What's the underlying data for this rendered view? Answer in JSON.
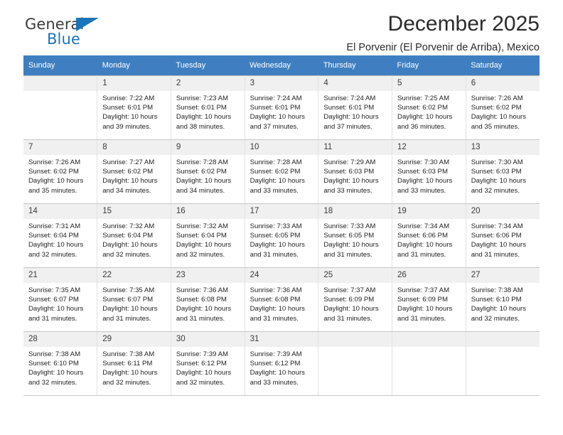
{
  "brand": {
    "name_part1": "General",
    "name_part2": "Blue",
    "logo_icon": "triangle-logo-icon"
  },
  "header": {
    "month_title": "December 2025",
    "location": "El Porvenir (El Porvenir de Arriba), Mexico"
  },
  "colors": {
    "header_row_bg": "#3f7fc1",
    "brand_blue": "#1b75bb",
    "daynum_bg": "#f0f0f0",
    "cell_border": "#c8c8c8"
  },
  "calendar": {
    "weekday_headers": [
      "Sunday",
      "Monday",
      "Tuesday",
      "Wednesday",
      "Thursday",
      "Friday",
      "Saturday"
    ],
    "weeks": [
      [
        {
          "day": "",
          "sunrise": "",
          "sunset": "",
          "daylight1": "",
          "daylight2": "",
          "empty": true
        },
        {
          "day": "1",
          "sunrise": "Sunrise: 7:22 AM",
          "sunset": "Sunset: 6:01 PM",
          "daylight1": "Daylight: 10 hours",
          "daylight2": "and 39 minutes."
        },
        {
          "day": "2",
          "sunrise": "Sunrise: 7:23 AM",
          "sunset": "Sunset: 6:01 PM",
          "daylight1": "Daylight: 10 hours",
          "daylight2": "and 38 minutes."
        },
        {
          "day": "3",
          "sunrise": "Sunrise: 7:24 AM",
          "sunset": "Sunset: 6:01 PM",
          "daylight1": "Daylight: 10 hours",
          "daylight2": "and 37 minutes."
        },
        {
          "day": "4",
          "sunrise": "Sunrise: 7:24 AM",
          "sunset": "Sunset: 6:01 PM",
          "daylight1": "Daylight: 10 hours",
          "daylight2": "and 37 minutes."
        },
        {
          "day": "5",
          "sunrise": "Sunrise: 7:25 AM",
          "sunset": "Sunset: 6:02 PM",
          "daylight1": "Daylight: 10 hours",
          "daylight2": "and 36 minutes."
        },
        {
          "day": "6",
          "sunrise": "Sunrise: 7:26 AM",
          "sunset": "Sunset: 6:02 PM",
          "daylight1": "Daylight: 10 hours",
          "daylight2": "and 35 minutes."
        }
      ],
      [
        {
          "day": "7",
          "sunrise": "Sunrise: 7:26 AM",
          "sunset": "Sunset: 6:02 PM",
          "daylight1": "Daylight: 10 hours",
          "daylight2": "and 35 minutes."
        },
        {
          "day": "8",
          "sunrise": "Sunrise: 7:27 AM",
          "sunset": "Sunset: 6:02 PM",
          "daylight1": "Daylight: 10 hours",
          "daylight2": "and 34 minutes."
        },
        {
          "day": "9",
          "sunrise": "Sunrise: 7:28 AM",
          "sunset": "Sunset: 6:02 PM",
          "daylight1": "Daylight: 10 hours",
          "daylight2": "and 34 minutes."
        },
        {
          "day": "10",
          "sunrise": "Sunrise: 7:28 AM",
          "sunset": "Sunset: 6:02 PM",
          "daylight1": "Daylight: 10 hours",
          "daylight2": "and 33 minutes."
        },
        {
          "day": "11",
          "sunrise": "Sunrise: 7:29 AM",
          "sunset": "Sunset: 6:03 PM",
          "daylight1": "Daylight: 10 hours",
          "daylight2": "and 33 minutes."
        },
        {
          "day": "12",
          "sunrise": "Sunrise: 7:30 AM",
          "sunset": "Sunset: 6:03 PM",
          "daylight1": "Daylight: 10 hours",
          "daylight2": "and 33 minutes."
        },
        {
          "day": "13",
          "sunrise": "Sunrise: 7:30 AM",
          "sunset": "Sunset: 6:03 PM",
          "daylight1": "Daylight: 10 hours",
          "daylight2": "and 32 minutes."
        }
      ],
      [
        {
          "day": "14",
          "sunrise": "Sunrise: 7:31 AM",
          "sunset": "Sunset: 6:04 PM",
          "daylight1": "Daylight: 10 hours",
          "daylight2": "and 32 minutes."
        },
        {
          "day": "15",
          "sunrise": "Sunrise: 7:32 AM",
          "sunset": "Sunset: 6:04 PM",
          "daylight1": "Daylight: 10 hours",
          "daylight2": "and 32 minutes."
        },
        {
          "day": "16",
          "sunrise": "Sunrise: 7:32 AM",
          "sunset": "Sunset: 6:04 PM",
          "daylight1": "Daylight: 10 hours",
          "daylight2": "and 32 minutes."
        },
        {
          "day": "17",
          "sunrise": "Sunrise: 7:33 AM",
          "sunset": "Sunset: 6:05 PM",
          "daylight1": "Daylight: 10 hours",
          "daylight2": "and 31 minutes."
        },
        {
          "day": "18",
          "sunrise": "Sunrise: 7:33 AM",
          "sunset": "Sunset: 6:05 PM",
          "daylight1": "Daylight: 10 hours",
          "daylight2": "and 31 minutes."
        },
        {
          "day": "19",
          "sunrise": "Sunrise: 7:34 AM",
          "sunset": "Sunset: 6:06 PM",
          "daylight1": "Daylight: 10 hours",
          "daylight2": "and 31 minutes."
        },
        {
          "day": "20",
          "sunrise": "Sunrise: 7:34 AM",
          "sunset": "Sunset: 6:06 PM",
          "daylight1": "Daylight: 10 hours",
          "daylight2": "and 31 minutes."
        }
      ],
      [
        {
          "day": "21",
          "sunrise": "Sunrise: 7:35 AM",
          "sunset": "Sunset: 6:07 PM",
          "daylight1": "Daylight: 10 hours",
          "daylight2": "and 31 minutes."
        },
        {
          "day": "22",
          "sunrise": "Sunrise: 7:35 AM",
          "sunset": "Sunset: 6:07 PM",
          "daylight1": "Daylight: 10 hours",
          "daylight2": "and 31 minutes."
        },
        {
          "day": "23",
          "sunrise": "Sunrise: 7:36 AM",
          "sunset": "Sunset: 6:08 PM",
          "daylight1": "Daylight: 10 hours",
          "daylight2": "and 31 minutes."
        },
        {
          "day": "24",
          "sunrise": "Sunrise: 7:36 AM",
          "sunset": "Sunset: 6:08 PM",
          "daylight1": "Daylight: 10 hours",
          "daylight2": "and 31 minutes."
        },
        {
          "day": "25",
          "sunrise": "Sunrise: 7:37 AM",
          "sunset": "Sunset: 6:09 PM",
          "daylight1": "Daylight: 10 hours",
          "daylight2": "and 31 minutes."
        },
        {
          "day": "26",
          "sunrise": "Sunrise: 7:37 AM",
          "sunset": "Sunset: 6:09 PM",
          "daylight1": "Daylight: 10 hours",
          "daylight2": "and 31 minutes."
        },
        {
          "day": "27",
          "sunrise": "Sunrise: 7:38 AM",
          "sunset": "Sunset: 6:10 PM",
          "daylight1": "Daylight: 10 hours",
          "daylight2": "and 32 minutes."
        }
      ],
      [
        {
          "day": "28",
          "sunrise": "Sunrise: 7:38 AM",
          "sunset": "Sunset: 6:10 PM",
          "daylight1": "Daylight: 10 hours",
          "daylight2": "and 32 minutes."
        },
        {
          "day": "29",
          "sunrise": "Sunrise: 7:38 AM",
          "sunset": "Sunset: 6:11 PM",
          "daylight1": "Daylight: 10 hours",
          "daylight2": "and 32 minutes."
        },
        {
          "day": "30",
          "sunrise": "Sunrise: 7:39 AM",
          "sunset": "Sunset: 6:12 PM",
          "daylight1": "Daylight: 10 hours",
          "daylight2": "and 32 minutes."
        },
        {
          "day": "31",
          "sunrise": "Sunrise: 7:39 AM",
          "sunset": "Sunset: 6:12 PM",
          "daylight1": "Daylight: 10 hours",
          "daylight2": "and 33 minutes."
        },
        {
          "day": "",
          "sunrise": "",
          "sunset": "",
          "daylight1": "",
          "daylight2": "",
          "empty": true
        },
        {
          "day": "",
          "sunrise": "",
          "sunset": "",
          "daylight1": "",
          "daylight2": "",
          "empty": true
        },
        {
          "day": "",
          "sunrise": "",
          "sunset": "",
          "daylight1": "",
          "daylight2": "",
          "empty": true
        }
      ]
    ]
  }
}
